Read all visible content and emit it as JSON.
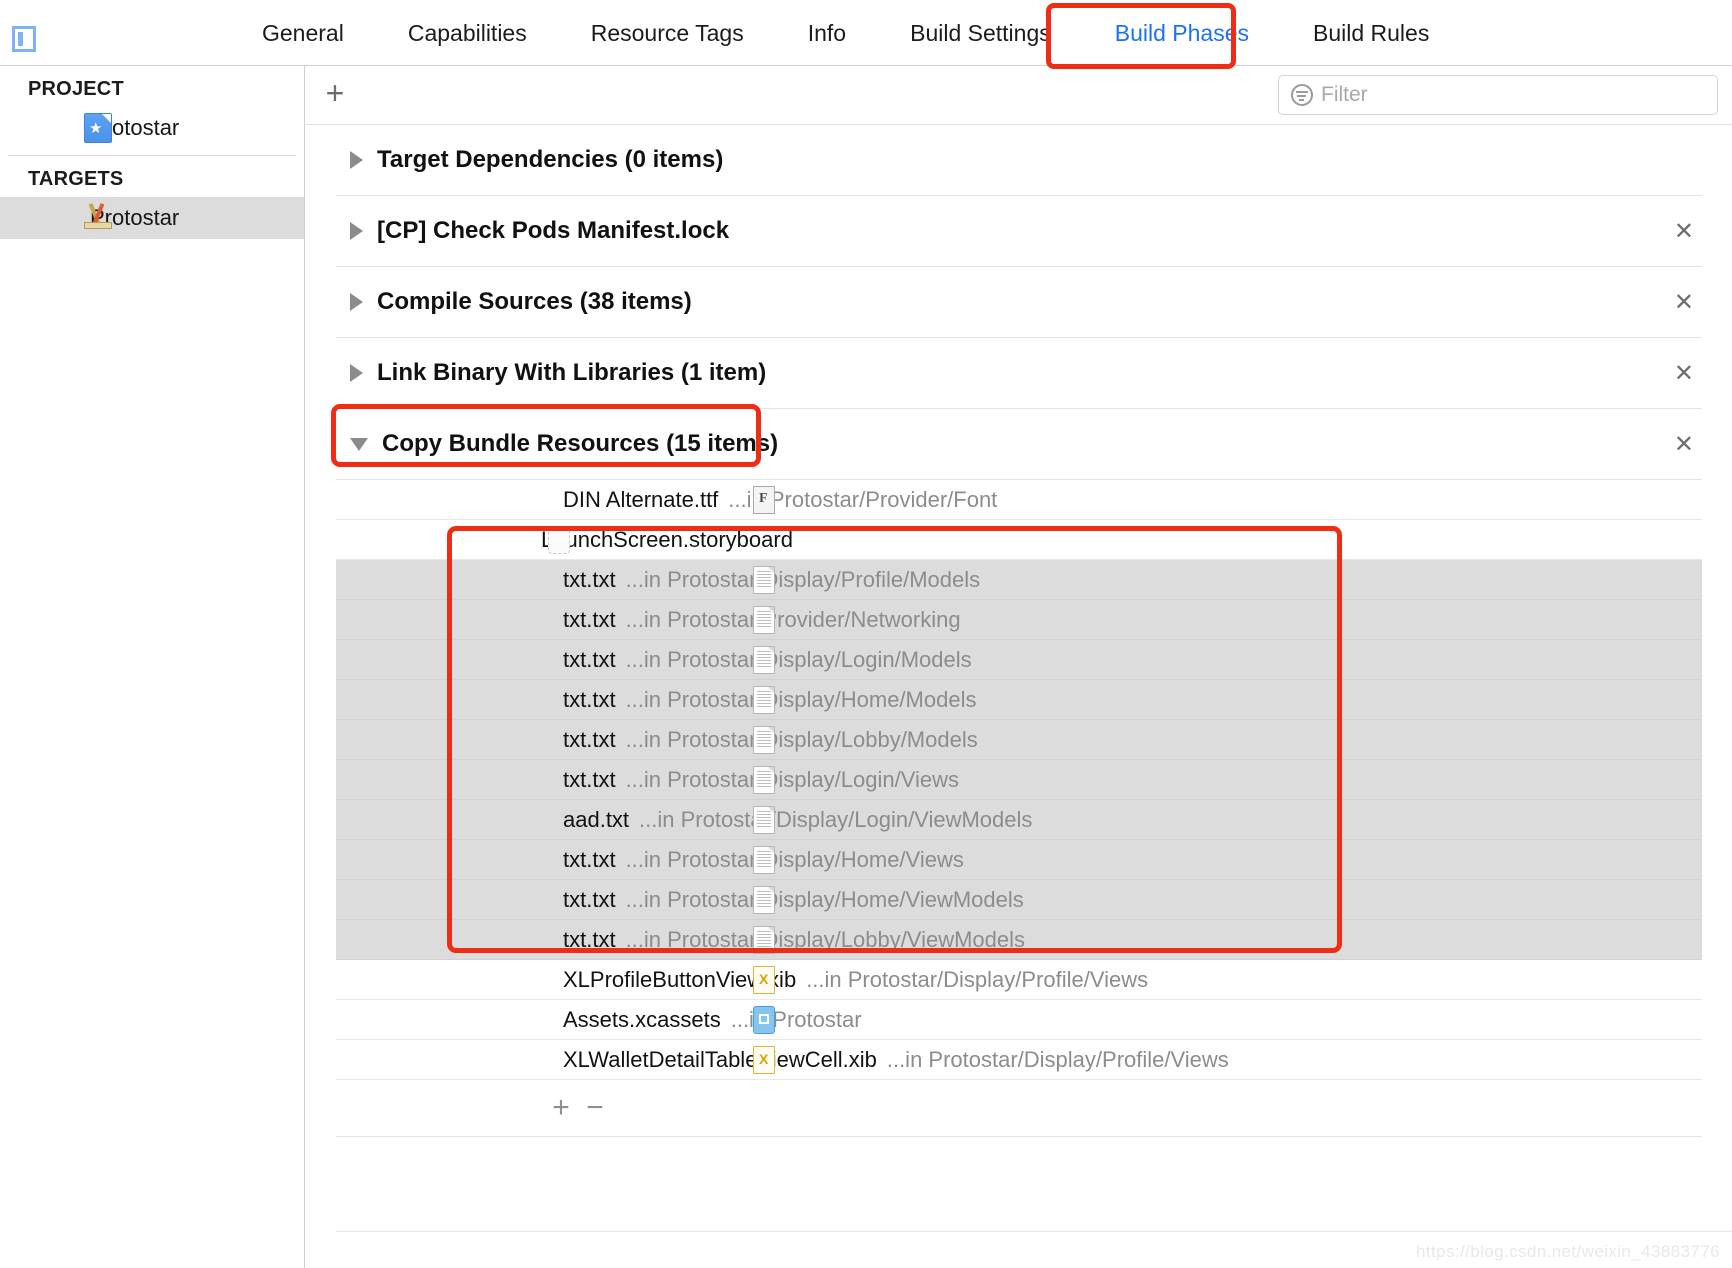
{
  "window": {
    "project_icon": "project-navigator-icon"
  },
  "tabs": [
    {
      "label": "General",
      "active": false
    },
    {
      "label": "Capabilities",
      "active": false
    },
    {
      "label": "Resource Tags",
      "active": false
    },
    {
      "label": "Info",
      "active": false
    },
    {
      "label": "Build Settings",
      "active": false
    },
    {
      "label": "Build Phases",
      "active": true
    },
    {
      "label": "Build Rules",
      "active": false
    }
  ],
  "sidebar": {
    "project_header": "PROJECT",
    "project_items": [
      {
        "label": "Protostar",
        "icon": "project-document-icon"
      }
    ],
    "targets_header": "TARGETS",
    "target_items": [
      {
        "label": "Protostar",
        "icon": "app-target-icon",
        "selected": true
      }
    ]
  },
  "toolbar": {
    "add_label": "+",
    "filter": {
      "placeholder": "Filter",
      "value": "",
      "icon": "filter-icon"
    }
  },
  "phases": [
    {
      "title": "Target Dependencies (0 items)",
      "expanded": false,
      "closable": false
    },
    {
      "title": "[CP] Check Pods Manifest.lock",
      "expanded": false,
      "closable": true
    },
    {
      "title": "Compile Sources (38 items)",
      "expanded": false,
      "closable": true
    },
    {
      "title": "Link Binary With Libraries (1 item)",
      "expanded": false,
      "closable": true
    },
    {
      "title": "Copy Bundle Resources (15 items)",
      "expanded": true,
      "closable": true
    }
  ],
  "files": [
    {
      "name": "DIN Alternate.ttf",
      "path": "...in Protostar/Provider/Font",
      "icon": "font-file-icon",
      "selected": false
    },
    {
      "name": "LaunchScreen.storyboard",
      "path": "",
      "icon": "storyboard-file-icon",
      "selected": false
    },
    {
      "name": "txt.txt",
      "path": "...in Protostar/Display/Profile/Models",
      "icon": "text-file-icon",
      "selected": true
    },
    {
      "name": "txt.txt",
      "path": "...in Protostar/Provider/Networking",
      "icon": "text-file-icon",
      "selected": true
    },
    {
      "name": "txt.txt",
      "path": "...in Protostar/Display/Login/Models",
      "icon": "text-file-icon",
      "selected": true
    },
    {
      "name": "txt.txt",
      "path": "...in Protostar/Display/Home/Models",
      "icon": "text-file-icon",
      "selected": true
    },
    {
      "name": "txt.txt",
      "path": "...in Protostar/Display/Lobby/Models",
      "icon": "text-file-icon",
      "selected": true
    },
    {
      "name": "txt.txt",
      "path": "...in Protostar/Display/Login/Views",
      "icon": "text-file-icon",
      "selected": true
    },
    {
      "name": "aad.txt",
      "path": "...in Protostar/Display/Login/ViewModels",
      "icon": "text-file-icon",
      "selected": true
    },
    {
      "name": "txt.txt",
      "path": "...in Protostar/Display/Home/Views",
      "icon": "text-file-icon",
      "selected": true
    },
    {
      "name": "txt.txt",
      "path": "...in Protostar/Display/Home/ViewModels",
      "icon": "text-file-icon",
      "selected": true
    },
    {
      "name": "txt.txt",
      "path": "...in Protostar/Display/Lobby/ViewModels",
      "icon": "text-file-icon",
      "selected": true
    },
    {
      "name": "XLProfileButtonView.xib",
      "path": "...in Protostar/Display/Profile/Views",
      "icon": "xib-file-icon",
      "selected": false
    },
    {
      "name": "Assets.xcassets",
      "path": "...in Protostar",
      "icon": "xcassets-file-icon",
      "selected": false
    },
    {
      "name": "XLWalletDetailTableViewCell.xib",
      "path": "...in Protostar/Display/Profile/Views",
      "icon": "xib-file-icon",
      "selected": false
    }
  ],
  "footer": {
    "add_label": "+",
    "remove_label": "−"
  },
  "annotations": {
    "color": "#ef2d14",
    "boxes": [
      "build-phases-tab",
      "copy-bundle-resources-phase",
      "selected-files-group"
    ]
  },
  "watermark": "https://blog.csdn.net/weixin_43883776"
}
